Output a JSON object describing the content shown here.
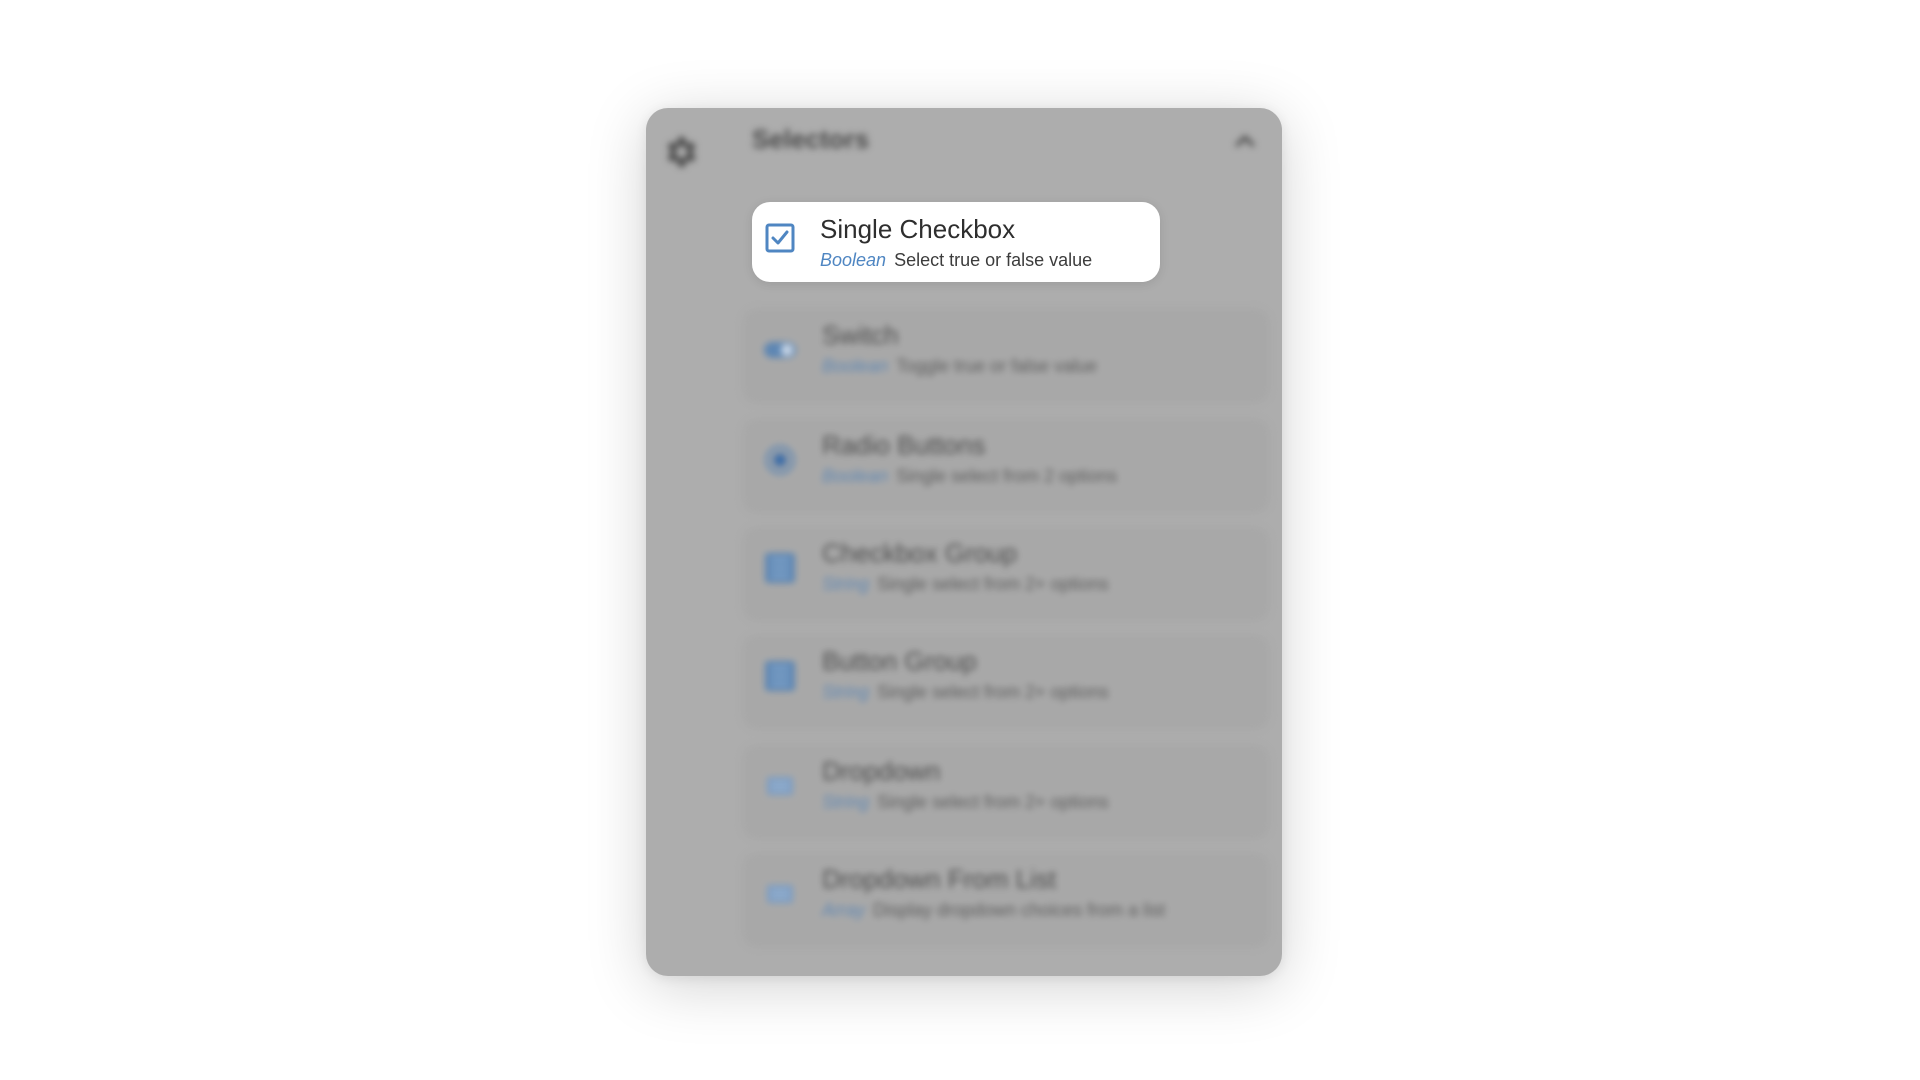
{
  "panel": {
    "title": "Selectors",
    "icons": {
      "settings": "gear-icon",
      "collapse": "chevron-up-icon"
    }
  },
  "items": [
    {
      "title": "Single Checkbox",
      "type": "Boolean",
      "description": "Select true or false value",
      "icon": "checkbox-checked-icon",
      "focused": true
    },
    {
      "title": "Switch",
      "type": "Boolean",
      "description": "Toggle true or false value",
      "icon": "toggle-icon"
    },
    {
      "title": "Radio Buttons",
      "type": "Boolean",
      "description": "Single select from 2 options",
      "icon": "radio-icon"
    },
    {
      "title": "Checkbox Group",
      "type": "String",
      "description": "Single select from 2+ options",
      "icon": "checkbox-group-icon"
    },
    {
      "title": "Button Group",
      "type": "String",
      "description": "Single select from 2+ options",
      "icon": "button-group-icon"
    },
    {
      "title": "Dropdown",
      "type": "String",
      "description": "Single select from 2+ options",
      "icon": "dropdown-icon"
    },
    {
      "title": "Dropdown From List",
      "type": "Array",
      "description": "Display dropdown choices from a list",
      "icon": "list-dropdown-icon"
    }
  ],
  "colors": {
    "accent": "#4f86c2",
    "panel_overlay": "#adadad"
  }
}
